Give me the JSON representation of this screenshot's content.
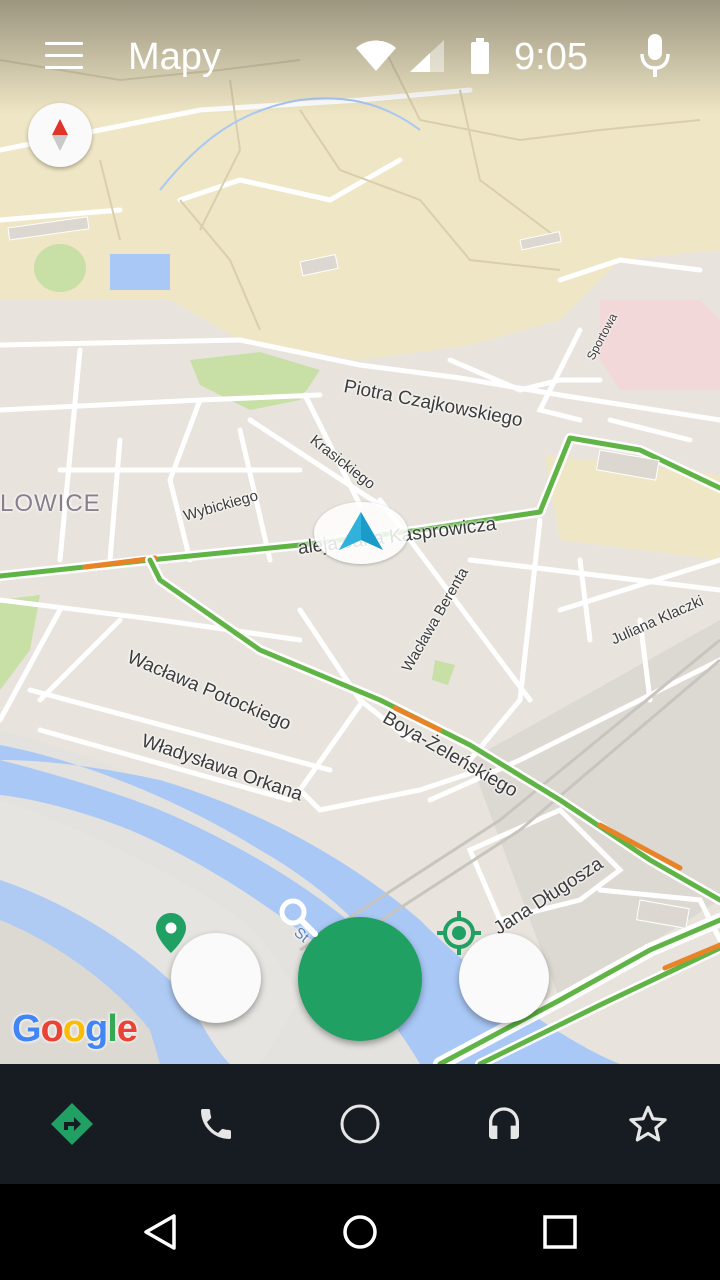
{
  "status_bar": {
    "app_title": "Mapy",
    "time": "9:05",
    "icons": [
      "wifi-icon",
      "cellular-signal-icon",
      "battery-icon",
      "microphone-icon"
    ]
  },
  "map": {
    "district_label": "LOWICE",
    "road_labels": {
      "czajkowskiego": "Piotra Czajkowskiego",
      "krasickiego": "Krasickiego",
      "wybickiego": "Wybickiego",
      "kasprowicza": "aleja Jana Kasprowicza",
      "berenta": "Wacława Berenta",
      "klaczki": "Juliana Klaczki",
      "potockiego": "Wacława Potockiego",
      "orkana": "Władysława Orkana",
      "boya": "Boya-Żeleńskiego",
      "dlugosza": "Jana Długosza",
      "sportowa": "Sportowa",
      "st": "St"
    },
    "attribution": [
      "G",
      "o",
      "o",
      "g",
      "l",
      "e"
    ],
    "colors": {
      "park": "#efe6c5",
      "green_area": "#c8dfa6",
      "water": "#a9c8f6",
      "traffic_green": "#5fb445",
      "traffic_orange": "#e88427",
      "accent": "#21a064"
    }
  },
  "fabs": {
    "place": "place-pin-icon",
    "search": "search-icon",
    "locate": "my-location-icon"
  },
  "dock": [
    "navigation-icon",
    "phone-icon",
    "home-circle-icon",
    "headphones-icon",
    "star-icon"
  ],
  "nav": [
    "back-icon",
    "home-icon",
    "recents-icon"
  ]
}
